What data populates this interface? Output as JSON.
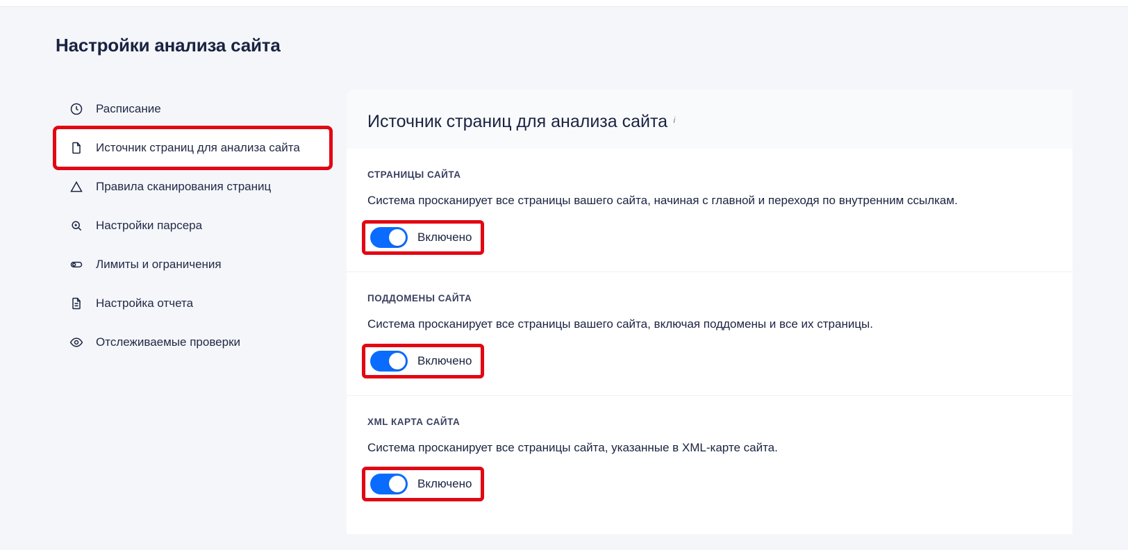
{
  "page": {
    "title": "Настройки анализа сайта"
  },
  "sidebar": {
    "items": [
      {
        "label": "Расписание"
      },
      {
        "label": "Источник страниц для анализа сайта"
      },
      {
        "label": "Правила сканирования страниц"
      },
      {
        "label": "Настройки парсера"
      },
      {
        "label": "Лимиты и ограничения"
      },
      {
        "label": "Настройка отчета"
      },
      {
        "label": "Отслеживаемые проверки"
      }
    ]
  },
  "content": {
    "title": "Источник страниц для анализа сайта",
    "info_mark": "i",
    "sections": [
      {
        "label": "СТРАНИЦЫ САЙТА",
        "desc": "Система просканирует все страницы вашего сайта, начиная с главной и переходя по внутренним ссылкам.",
        "toggle_label": "Включено"
      },
      {
        "label": "ПОДДОМЕНЫ САЙТА",
        "desc": "Система просканирует все страницы вашего сайта, включая поддомены и все их страницы.",
        "toggle_label": "Включено"
      },
      {
        "label": "XML КАРТА САЙТА",
        "desc": "Система просканирует все страницы сайта, указанные в XML-карте сайта.",
        "toggle_label": "Включено"
      }
    ]
  }
}
